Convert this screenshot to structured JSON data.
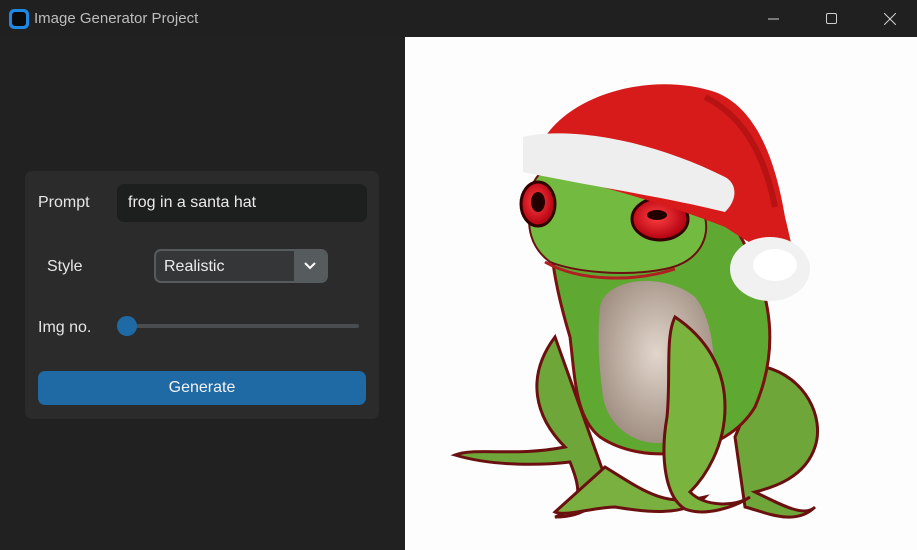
{
  "window": {
    "title": "Image Generator Project",
    "icons": [
      "app-icon",
      "minimize-icon",
      "maximize-icon",
      "close-icon"
    ]
  },
  "form": {
    "prompt_label": "Prompt",
    "prompt_value": "frog in a santa hat",
    "style_label": "Style",
    "style_value": "Realistic",
    "img_no_label": "Img no.",
    "img_no_slider_fraction": 0,
    "generate_label": "Generate"
  },
  "colors": {
    "accent": "#1f6aa5",
    "panel": "#2b2b2b",
    "background": "#212121"
  }
}
